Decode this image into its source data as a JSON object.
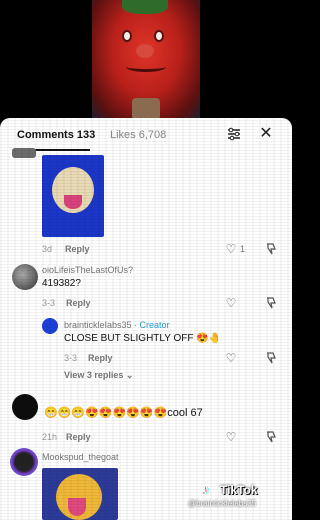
{
  "header": {
    "comments_label": "Comments 133",
    "likes_label": "Likes 6,708"
  },
  "comments": [
    {
      "meta": "3d",
      "reply_label": "Reply"
    },
    {
      "username": "oioLifeisTheLastOfUs?",
      "text": "419382?",
      "meta": "3-3",
      "reply_label": "Reply"
    },
    {
      "username": "braintickleIabs35",
      "creator_tag": " · Creator",
      "text": "CLOSE BUT SLIGHTLY OFF 😍🤚",
      "meta": "3-3",
      "reply_label": "Reply"
    },
    {
      "text": "😁😁😁😍😍😍😍😍😍cool 67",
      "meta": "21h",
      "reply_label": "Reply"
    },
    {
      "username": "Mookspud_thegoat"
    }
  ],
  "view_replies": "View 3 replies ⌄",
  "watermark": {
    "brand": "TikTok",
    "handle": "@braintickleIabs35"
  },
  "icons": {
    "filter": "filter-icon",
    "close": "close-icon",
    "heart": "heart-icon",
    "dislike": "dislike-icon"
  }
}
